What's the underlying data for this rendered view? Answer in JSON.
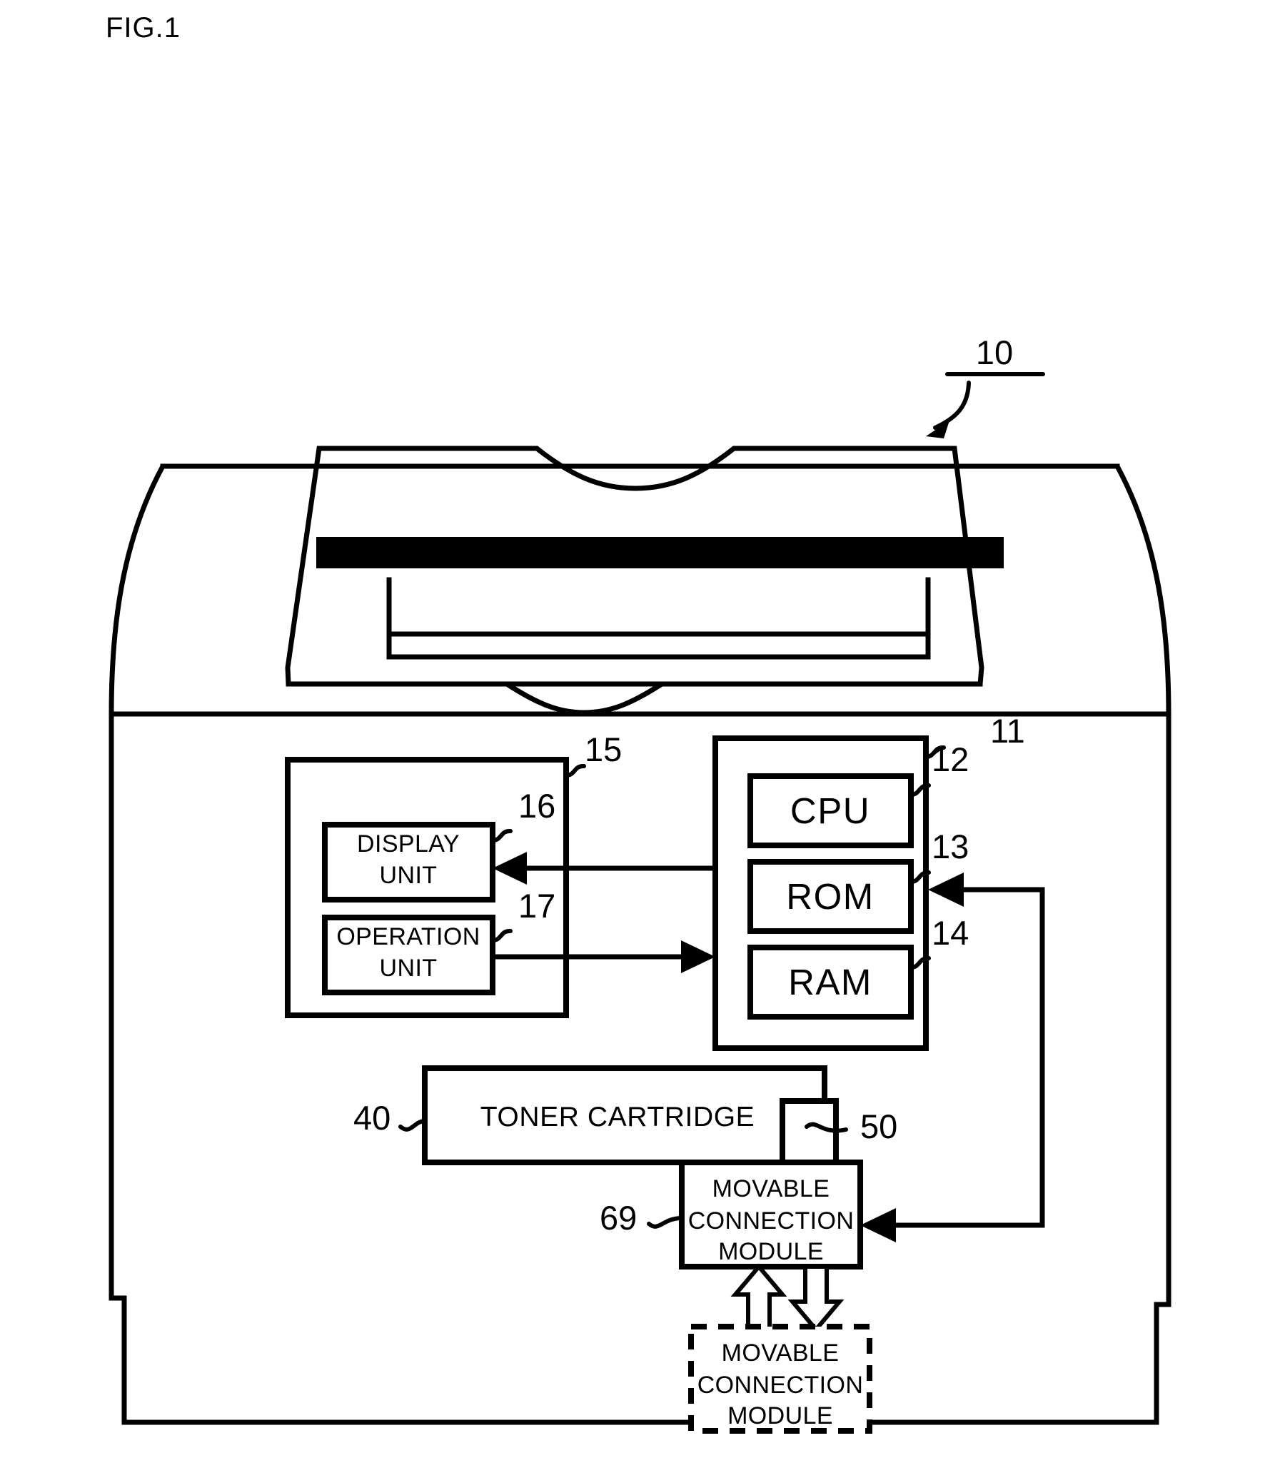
{
  "figure": {
    "label": "FIG.1",
    "device_ref": "10"
  },
  "refs": {
    "device": "10",
    "controller": "11",
    "cpu": "12",
    "rom": "13",
    "ram": "14",
    "panel": "15",
    "display": "16",
    "operation": "17",
    "toner_cartridge": "40",
    "cartridge_memory": "50",
    "movable_connection": "69"
  },
  "blocks": {
    "cpu": "CPU",
    "rom": "ROM",
    "ram": "RAM",
    "display_unit_line1": "DISPLAY",
    "display_unit_line2": "UNIT",
    "operation_unit_line1": "OPERATION",
    "operation_unit_line2": "UNIT",
    "toner_cartridge": "TONER CARTRIDGE",
    "movable_connection_line1": "MOVABLE",
    "movable_connection_line2": "CONNECTION",
    "movable_connection_line3": "MODULE",
    "movable_connection_alt_line1": "MOVABLE",
    "movable_connection_alt_line2": "CONNECTION",
    "movable_connection_alt_line3": "MODULE"
  },
  "colors": {
    "ink": "#000000",
    "paper": "#ffffff"
  }
}
